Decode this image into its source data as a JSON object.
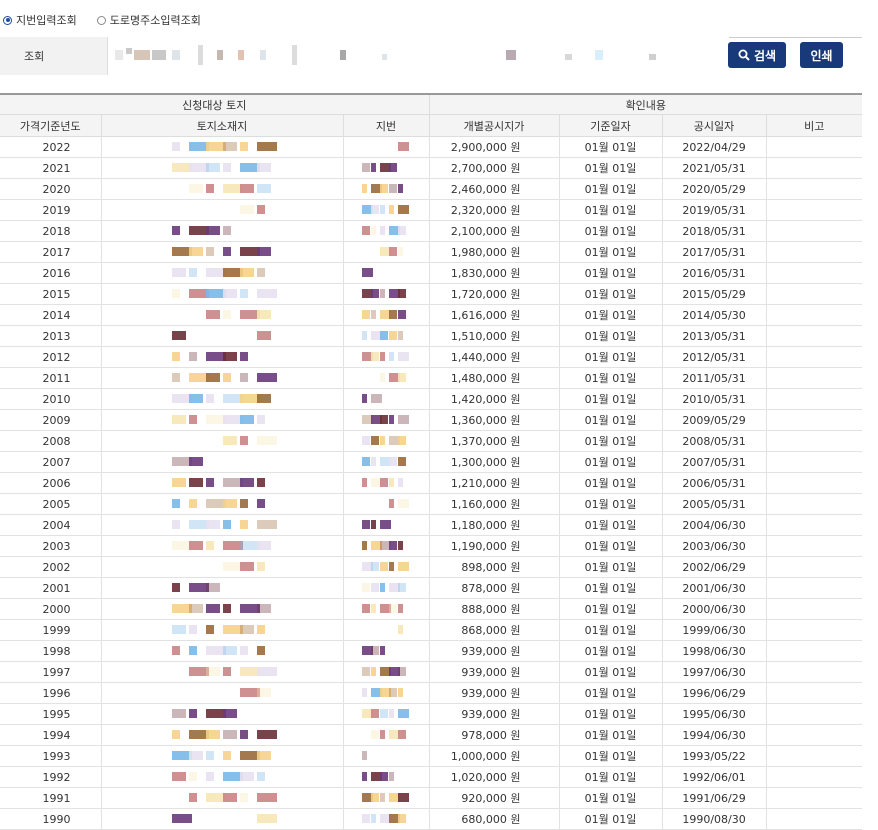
{
  "radios": [
    {
      "label": "지번입력조회",
      "selected": true
    },
    {
      "label": "도로명주소입력조회",
      "selected": false
    }
  ],
  "search": {
    "label": "조회",
    "search_button": "검색",
    "print_button": "인쇄",
    "search_icon": "magnifier-icon"
  },
  "table": {
    "group_headers": {
      "left": "신청대상 토지",
      "right": "확인내용"
    },
    "columns": [
      "가격기준년도",
      "토지소재지",
      "지번",
      "개별공시지가",
      "기준일자",
      "공시일자",
      "비고"
    ],
    "rows": [
      {
        "year": "2022",
        "price": "2,900,000 원",
        "base": "01월 01일",
        "date": "2022/04/29",
        "note": ""
      },
      {
        "year": "2021",
        "price": "2,700,000 원",
        "base": "01월 01일",
        "date": "2021/05/31",
        "note": ""
      },
      {
        "year": "2020",
        "price": "2,460,000 원",
        "base": "01월 01일",
        "date": "2020/05/29",
        "note": ""
      },
      {
        "year": "2019",
        "price": "2,320,000 원",
        "base": "01월 01일",
        "date": "2019/05/31",
        "note": ""
      },
      {
        "year": "2018",
        "price": "2,100,000 원",
        "base": "01월 01일",
        "date": "2018/05/31",
        "note": ""
      },
      {
        "year": "2017",
        "price": "1,980,000 원",
        "base": "01월 01일",
        "date": "2017/05/31",
        "note": ""
      },
      {
        "year": "2016",
        "price": "1,830,000 원",
        "base": "01월 01일",
        "date": "2016/05/31",
        "note": ""
      },
      {
        "year": "2015",
        "price": "1,720,000 원",
        "base": "01월 01일",
        "date": "2015/05/29",
        "note": ""
      },
      {
        "year": "2014",
        "price": "1,616,000 원",
        "base": "01월 01일",
        "date": "2014/05/30",
        "note": ""
      },
      {
        "year": "2013",
        "price": "1,510,000 원",
        "base": "01월 01일",
        "date": "2013/05/31",
        "note": ""
      },
      {
        "year": "2012",
        "price": "1,440,000 원",
        "base": "01월 01일",
        "date": "2012/05/31",
        "note": ""
      },
      {
        "year": "2011",
        "price": "1,480,000 원",
        "base": "01월 01일",
        "date": "2011/05/31",
        "note": ""
      },
      {
        "year": "2010",
        "price": "1,420,000 원",
        "base": "01월 01일",
        "date": "2010/05/31",
        "note": ""
      },
      {
        "year": "2009",
        "price": "1,360,000 원",
        "base": "01월 01일",
        "date": "2009/05/29",
        "note": ""
      },
      {
        "year": "2008",
        "price": "1,370,000 원",
        "base": "01월 01일",
        "date": "2008/05/31",
        "note": ""
      },
      {
        "year": "2007",
        "price": "1,300,000 원",
        "base": "01월 01일",
        "date": "2007/05/31",
        "note": ""
      },
      {
        "year": "2006",
        "price": "1,210,000 원",
        "base": "01월 01일",
        "date": "2006/05/31",
        "note": ""
      },
      {
        "year": "2005",
        "price": "1,160,000 원",
        "base": "01월 01일",
        "date": "2005/05/31",
        "note": ""
      },
      {
        "year": "2004",
        "price": "1,180,000 원",
        "base": "01월 01일",
        "date": "2004/06/30",
        "note": ""
      },
      {
        "year": "2003",
        "price": "1,190,000 원",
        "base": "01월 01일",
        "date": "2003/06/30",
        "note": ""
      },
      {
        "year": "2002",
        "price": "898,000 원",
        "base": "01월 01일",
        "date": "2002/06/29",
        "note": ""
      },
      {
        "year": "2001",
        "price": "878,000 원",
        "base": "01월 01일",
        "date": "2001/06/30",
        "note": ""
      },
      {
        "year": "2000",
        "price": "888,000 원",
        "base": "01월 01일",
        "date": "2000/06/30",
        "note": ""
      },
      {
        "year": "1999",
        "price": "868,000 원",
        "base": "01월 01일",
        "date": "1999/06/30",
        "note": ""
      },
      {
        "year": "1998",
        "price": "939,000 원",
        "base": "01월 01일",
        "date": "1998/06/30",
        "note": ""
      },
      {
        "year": "1997",
        "price": "939,000 원",
        "base": "01월 01일",
        "date": "1997/06/30",
        "note": ""
      },
      {
        "year": "1996",
        "price": "939,000 원",
        "base": "01월 01일",
        "date": "1996/06/29",
        "note": ""
      },
      {
        "year": "1995",
        "price": "939,000 원",
        "base": "01월 01일",
        "date": "1995/06/30",
        "note": ""
      },
      {
        "year": "1994",
        "price": "978,000 원",
        "base": "01월 01일",
        "date": "1994/06/30",
        "note": ""
      },
      {
        "year": "1993",
        "price": "1,000,000 원",
        "base": "01월 01일",
        "date": "1993/05/22",
        "note": ""
      },
      {
        "year": "1992",
        "price": "1,020,000 원",
        "base": "01월 01일",
        "date": "1992/06/01",
        "note": ""
      },
      {
        "year": "1991",
        "price": "920,000 원",
        "base": "01월 01일",
        "date": "1991/06/29",
        "note": ""
      },
      {
        "year": "1990",
        "price": "680,000 원",
        "base": "01월 01일",
        "date": "1990/08/30",
        "note": ""
      }
    ]
  },
  "colors": {
    "button_bg": "#183a7a",
    "radio_accent": "#1a4ea3",
    "header_bg": "#f4f4f4"
  }
}
